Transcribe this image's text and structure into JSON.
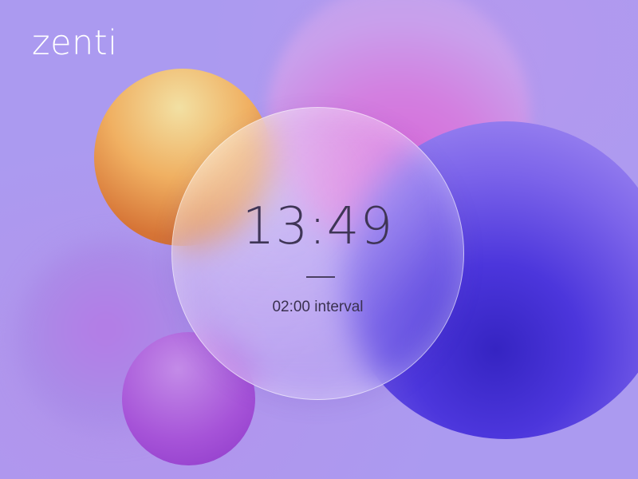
{
  "app": {
    "logo_text": "zenti"
  },
  "clock": {
    "time": "13:49",
    "interval_label": "02:00 interval"
  },
  "colors": {
    "background": "#ab9af0",
    "text_dark": "#3f3556",
    "logo": "#ffffff",
    "orb_orange": "#f0b062",
    "orb_pink": "#d766d8",
    "orb_indigo": "#4c36dc",
    "orb_purple": "#a653d8"
  }
}
